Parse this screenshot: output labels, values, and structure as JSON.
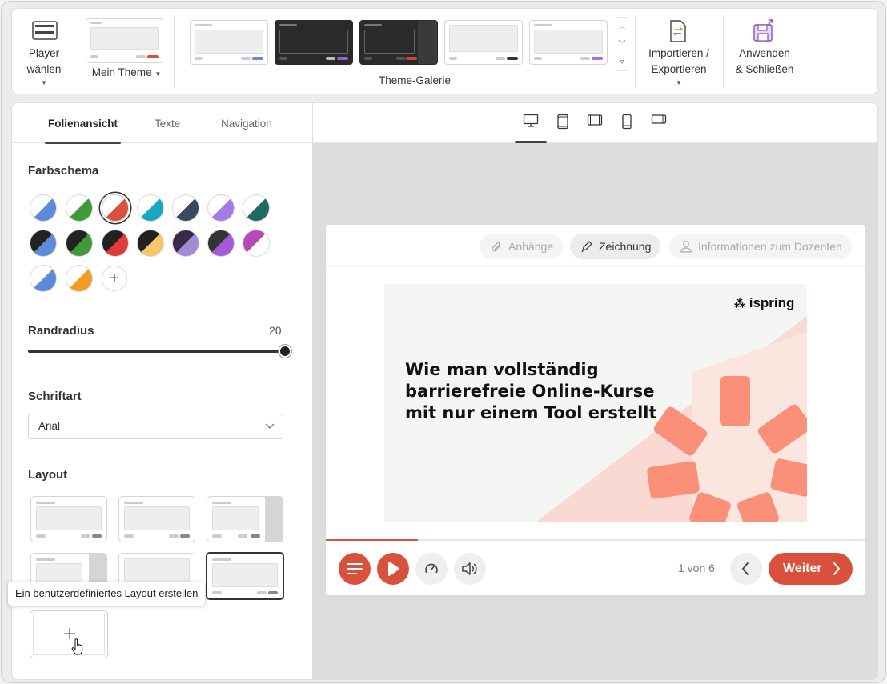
{
  "ribbon": {
    "player": {
      "line1": "Player",
      "line2": "wählen"
    },
    "theme": {
      "label": "Mein Theme"
    },
    "gallery": {
      "label": "Theme-Galerie"
    },
    "import": {
      "line1": "Importieren /",
      "line2": "Exportieren"
    },
    "apply": {
      "line1": "Anwenden",
      "line2": "& Schließen"
    }
  },
  "tabs": [
    "Folienansicht",
    "Texte",
    "Navigation"
  ],
  "colors": {
    "accent": "#d9513c",
    "dark": "#222222"
  },
  "left": {
    "color_scheme_title": "Farbschema",
    "border_radius_title": "Randradius",
    "border_radius_value": "20",
    "font_title": "Schriftart",
    "font_value": "Arial",
    "layout_title": "Layout",
    "tooltip": "Ein benutzerdefiniertes Layout erstellen"
  },
  "player": {
    "attachments": "Anhänge",
    "drawing": "Zeichnung",
    "instructor": "Informationen zum Dozenten",
    "slide_title": "Wie man vollständig barrierefreie Online-Kurse mit nur einem Tool erstellt",
    "logo": "ispring",
    "counter": "1 von 6",
    "next": "Weiter",
    "progress": 0.17
  }
}
